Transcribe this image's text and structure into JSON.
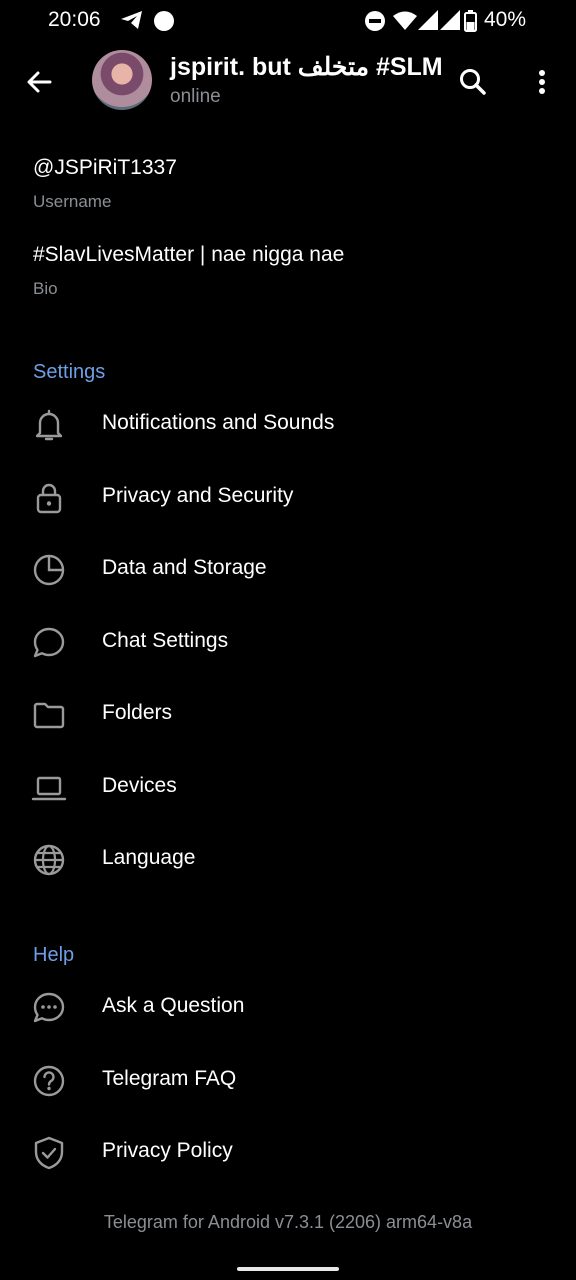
{
  "status": {
    "time": "20:06",
    "battery": "40%"
  },
  "header": {
    "title": "jspirit. but متخلف #SLM",
    "subtitle": "online"
  },
  "profile": {
    "username_value": "@JSPiRiT1337",
    "username_label": "Username",
    "bio_value": "#SlavLivesMatter | nae nigga nae",
    "bio_label": "Bio"
  },
  "settings": {
    "header": "Settings",
    "items": [
      {
        "label": "Notifications and Sounds",
        "icon": "bell-icon"
      },
      {
        "label": "Privacy and Security",
        "icon": "lock-icon"
      },
      {
        "label": "Data and Storage",
        "icon": "pie-chart-icon"
      },
      {
        "label": "Chat Settings",
        "icon": "chat-bubble-icon"
      },
      {
        "label": "Folders",
        "icon": "folder-icon"
      },
      {
        "label": "Devices",
        "icon": "laptop-icon"
      },
      {
        "label": "Language",
        "icon": "globe-icon"
      }
    ]
  },
  "help": {
    "header": "Help",
    "items": [
      {
        "label": "Ask a Question",
        "icon": "chat-dots-icon"
      },
      {
        "label": "Telegram FAQ",
        "icon": "question-circle-icon"
      },
      {
        "label": "Privacy Policy",
        "icon": "shield-icon"
      }
    ]
  },
  "footer": {
    "version": "Telegram for Android v7.3.1 (2206) arm64-v8a"
  },
  "colors": {
    "accent": "#6e9fe6",
    "secondary_text": "#8b8f93",
    "background": "#000000"
  }
}
